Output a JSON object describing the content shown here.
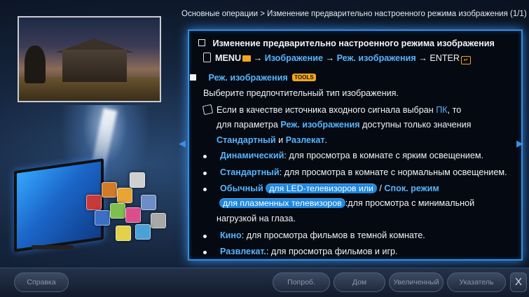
{
  "breadcrumb": "Основные операции > Изменение предварительно настроенного режима изображения (1/1)",
  "section": {
    "title": "Изменение предварительно настроенного режима изображения",
    "path": {
      "menu": "MENU",
      "arrow": "→",
      "step1": "Изображение",
      "step2": "Реж. изображения",
      "enter": "ENTER"
    }
  },
  "item": {
    "title": "Реж. изображения",
    "tools_badge": "TOOLS",
    "desc": "Выберите предпочтительный тип изображения.",
    "note": {
      "part1": "Если в качестве источника входного сигнала выбран ",
      "pc": "ПК",
      "part2": ", то",
      "line2_a": "для параметра ",
      "line2_b": "Реж. изображения",
      "line2_c": " доступны только значения",
      "opt1": "Стандартный",
      "and": " и ",
      "opt2": "Разлекат",
      "end": "."
    },
    "bullets": [
      {
        "term": "Динамический",
        "text": ": для просмотра в комнате с ярким освещением."
      },
      {
        "term": "Стандартный",
        "text": ": для просмотра в комнате с нормальным освещением."
      },
      {
        "term": "Обычный",
        "pill1": "для LED-телевизоров или",
        "sep": " / ",
        "term2": "Спок. режим",
        "pill2": "для плазменных телевизоров",
        "text": ":для просмотра с минимальной",
        "text2": "нагрузкой на глаза."
      },
      {
        "term": "Кино",
        "text": ": для просмотра фильмов в темной комнате."
      },
      {
        "term": "Развлекат.",
        "text": ": для просмотра фильмов и игр."
      }
    ]
  },
  "nav": {
    "left": "◀",
    "right": "▶"
  },
  "buttons": {
    "help": "Справка",
    "try": "Попроб.",
    "home": "Дом",
    "zoom": "Увеличенный",
    "index": "Указатель",
    "close": "X"
  },
  "colors": {
    "accent_blue": "#56b4ff",
    "panel_border": "#2d8fe0",
    "tools_orange": "#f2a51e",
    "highlight_pill": "#1e88e0"
  },
  "icons": [
    "remote-icon",
    "menu-icon",
    "enter-icon",
    "tools-icon",
    "note-icon",
    "arrow-left-icon",
    "arrow-right-icon"
  ]
}
